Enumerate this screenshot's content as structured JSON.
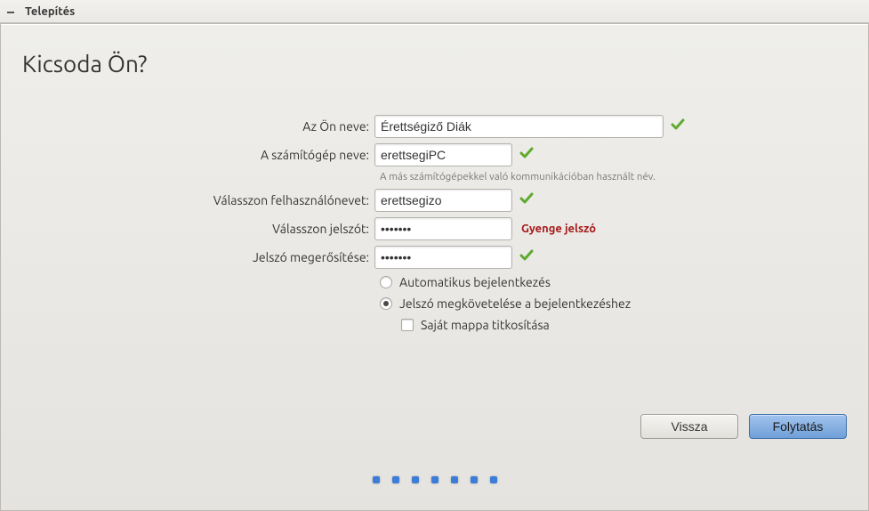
{
  "window": {
    "title": "Telepítés"
  },
  "header": {
    "heading": "Kicsoda Ön?"
  },
  "form": {
    "name": {
      "label": "Az Ön neve:",
      "value": "Érettségiző Diák"
    },
    "computer": {
      "label": "A számítógép neve:",
      "value": "erettsegiPC",
      "help": "A más számítógépekkel való kommunikációban használt név."
    },
    "username": {
      "label": "Válasszon felhasználónevet:",
      "value": "erettsegizo"
    },
    "password": {
      "label": "Válasszon jelszót:",
      "value": "•••••••",
      "strength": "Gyenge jelszó"
    },
    "confirm": {
      "label": "Jelszó megerősítése:",
      "value": "•••••••"
    },
    "login_options": {
      "auto": {
        "label": "Automatikus bejelentkezés",
        "selected": false
      },
      "require": {
        "label": "Jelszó megkövetelése a bejelentkezéshez",
        "selected": true
      },
      "encrypt": {
        "label": "Saját mappa titkosítása",
        "checked": false
      }
    }
  },
  "buttons": {
    "back": "Vissza",
    "continue": "Folytatás"
  },
  "progress": {
    "total_dots": 7
  }
}
